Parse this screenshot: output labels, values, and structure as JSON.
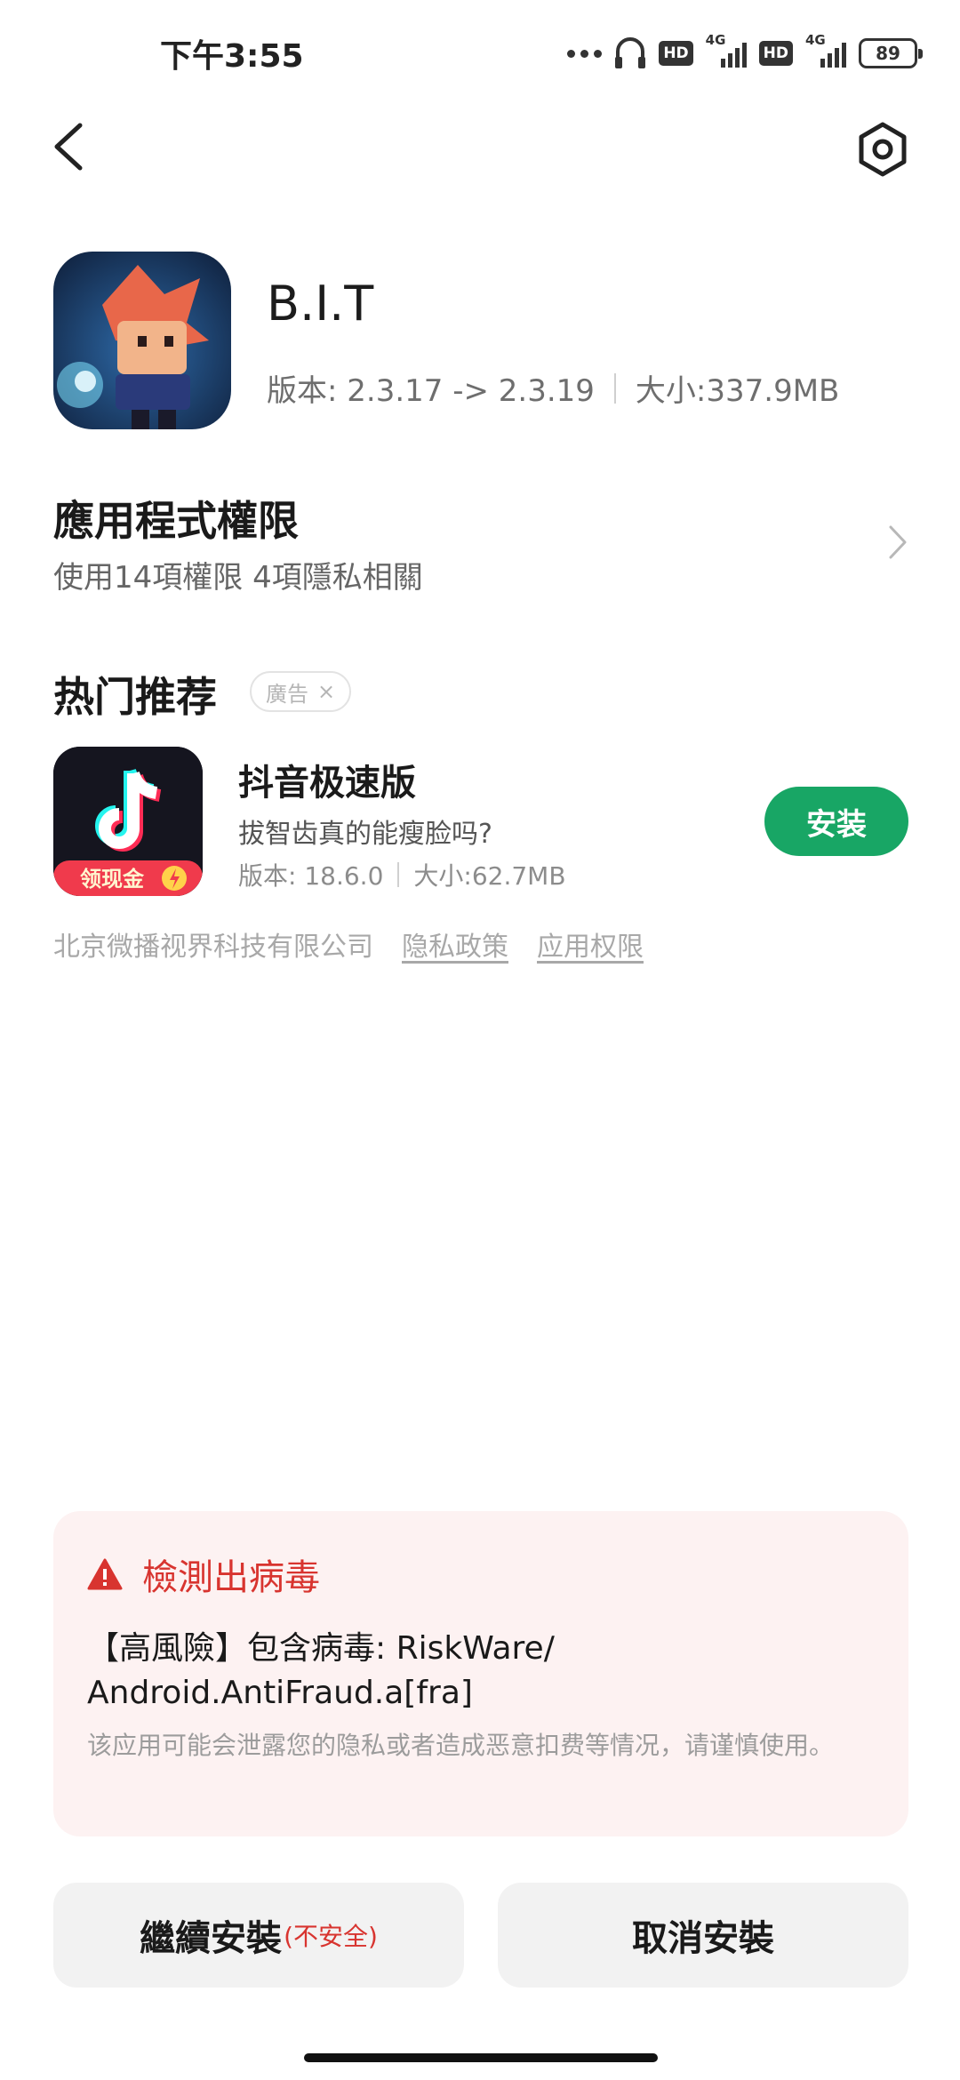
{
  "status_bar": {
    "time": "下午3:55",
    "hd_label_1": "HD",
    "hd_label_2": "HD",
    "network_label_1": "4G",
    "network_label_2": "4G",
    "battery": "89"
  },
  "app": {
    "name": "B.I.T",
    "version": "版本: 2.3.17 -> 2.3.19",
    "size": "大小:337.9MB"
  },
  "permissions": {
    "title": "應用程式權限",
    "subtitle": "使用14項權限 4項隱私相關"
  },
  "recommend": {
    "section_title": "热门推荐",
    "ad_label": "廣告",
    "ad_close": "×",
    "app_name": "抖音极速版",
    "description": "拔智齿真的能瘦脸吗?",
    "version": "版本: 18.6.0",
    "size": "大小:62.7MB",
    "install_label": "安装",
    "icon_banner": "领现金",
    "developer": "北京微播视界科技有限公司",
    "privacy_link": "隐私政策",
    "permission_link": "应用权限"
  },
  "warning": {
    "title": "檢測出病毒",
    "body": "【高風險】包含病毒: RiskWare/ Android.AntiFraud.a[fra]",
    "note": "该应用可能会泄露您的隐私或者造成恶意扣费等情况，请谨慎使用。",
    "accent_color": "#d8342f"
  },
  "buttons": {
    "continue_label": "繼續安裝",
    "continue_suffix": "(不安全)",
    "cancel_label": "取消安裝"
  },
  "colors": {
    "install_green": "#18a665",
    "warning_bg": "#fdf2f2"
  }
}
